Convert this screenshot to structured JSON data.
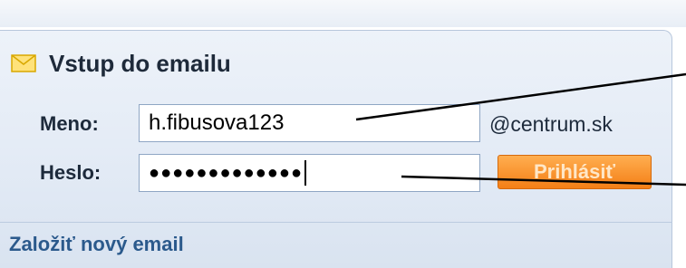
{
  "widget": {
    "title": "Vstup do emailu",
    "icon": "mail-envelope-icon"
  },
  "login": {
    "username_label": "Meno:",
    "username_value": "h.fibusova123",
    "domain_suffix": "@centrum.sk",
    "password_label": "Heslo:",
    "password_masked": "●●●●●●●●●●●●●",
    "submit_label": "Prihlásiť"
  },
  "footer": {
    "create_account_link": "Založiť nový email"
  },
  "colors": {
    "accent_button": "#f47f16",
    "link": "#2b5a8c",
    "panel_bg": "#e2eaf5"
  }
}
